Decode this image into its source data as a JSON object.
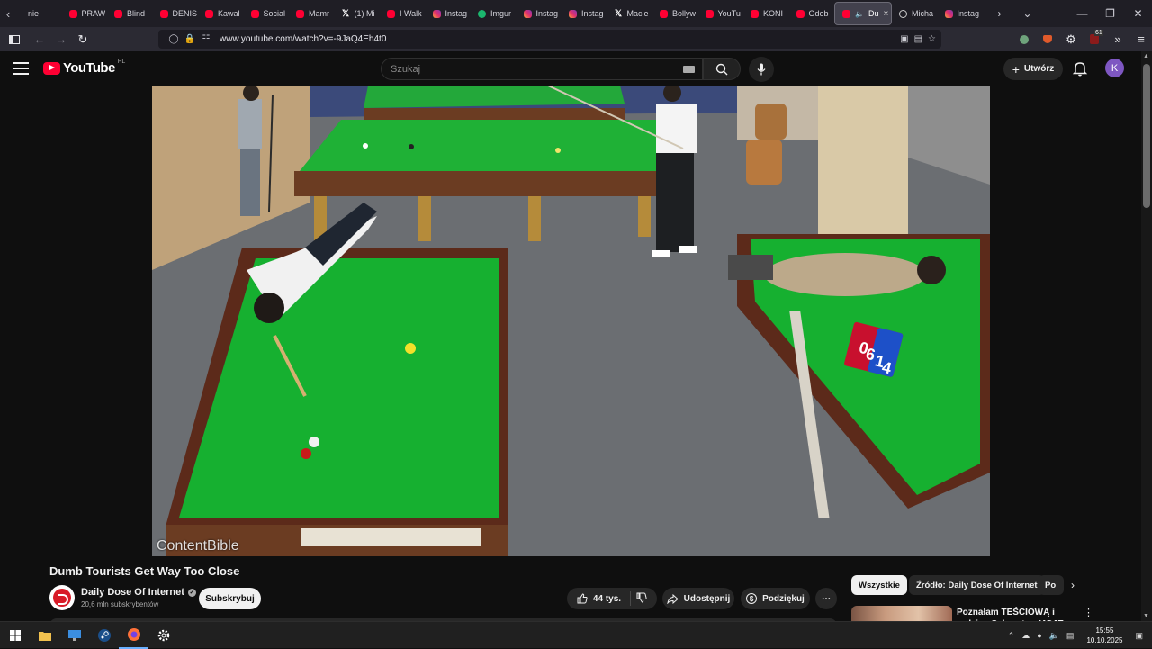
{
  "browser": {
    "tabs": [
      {
        "label": "nie",
        "icon": "partial"
      },
      {
        "label": "PRAW",
        "icon": "youtube-icon"
      },
      {
        "label": "Blind",
        "icon": "youtube-icon"
      },
      {
        "label": "DENIS",
        "icon": "youtube-icon"
      },
      {
        "label": "Kawal",
        "icon": "youtube-icon"
      },
      {
        "label": "Social",
        "icon": "youtube-icon"
      },
      {
        "label": "Mamr",
        "icon": "youtube-icon"
      },
      {
        "label": "(1) Mi",
        "icon": "x-icon"
      },
      {
        "label": "I Walk",
        "icon": "youtube-icon"
      },
      {
        "label": "Instag",
        "icon": "instagram-icon"
      },
      {
        "label": "Imgur",
        "icon": "imgur-icon"
      },
      {
        "label": "Instag",
        "icon": "instagram-icon"
      },
      {
        "label": "Instag",
        "icon": "instagram-icon"
      },
      {
        "label": "Macie",
        "icon": "x-icon"
      },
      {
        "label": "Bollyw",
        "icon": "youtube-icon"
      },
      {
        "label": "YouTu",
        "icon": "youtube-icon"
      },
      {
        "label": "KONI",
        "icon": "youtube-icon"
      },
      {
        "label": "Odeb",
        "icon": "youtube-icon"
      }
    ],
    "active_tab": {
      "label": "Du",
      "icon": "youtube-icon"
    },
    "tabs_after": [
      {
        "label": "Micha",
        "icon": "michal-icon"
      },
      {
        "label": "Instag",
        "icon": "instagram-icon"
      }
    ],
    "url": "www.youtube.com/watch?v=-9JaQ4Eh4t0",
    "extension_badge": "61"
  },
  "youtube": {
    "logo_text": "YouTube",
    "region": "PL",
    "search_placeholder": "Szukaj",
    "create_label": "Utwórz",
    "avatar_letter": "K"
  },
  "video": {
    "watermark": "ContentBible",
    "scoreboard": [
      "0",
      "6",
      "1",
      "4"
    ],
    "title": "Dumb Tourists Get Way Too Close",
    "channel": "Daily Dose Of Internet",
    "subscribers": "20,6 mln subskrybentów",
    "subscribe_label": "Subskrybuj",
    "likes": "44 tys.",
    "share_label": "Udostępnij",
    "thanks_label": "Podziękuj"
  },
  "sidebar": {
    "chips": [
      "Wszystkie",
      "Źródło: Daily Dose Of Internet",
      "Po"
    ],
    "rec_title": "Poznałam TEŚCIOWĄ i rodzinę Sylwestra. MOJE URODZINY!"
  },
  "taskbar": {
    "time": "15:55",
    "date": "10.10.2025"
  }
}
